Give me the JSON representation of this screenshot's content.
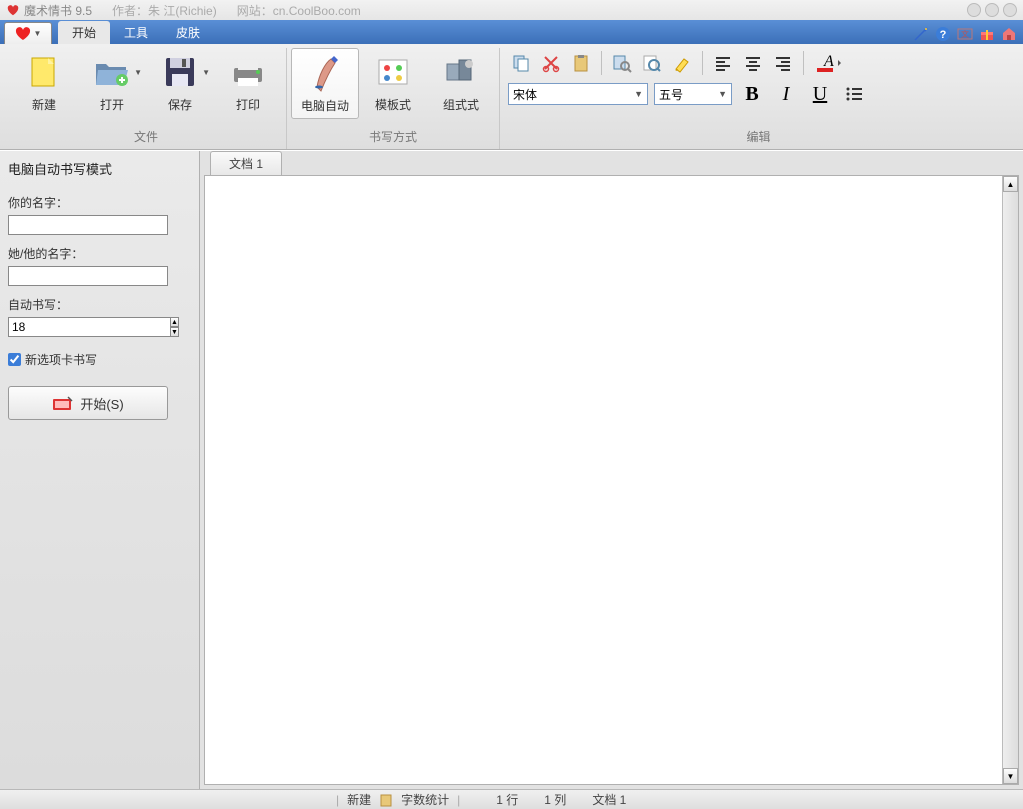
{
  "title": {
    "app": "魔术情书 9.5",
    "author": "作者：朱 江(Richie)",
    "url": "网站：cn.CoolBoo.com"
  },
  "menu": {
    "tabs": [
      "开始",
      "工具",
      "皮肤"
    ],
    "active": 0
  },
  "ribbon": {
    "file": {
      "label": "文件",
      "new": "新建",
      "open": "打开",
      "save": "保存",
      "print": "打印"
    },
    "write_mode": {
      "label": "书写方式",
      "auto": "电脑自动",
      "template": "模板式",
      "group": "组式式"
    },
    "edit": {
      "label": "编辑",
      "font": "宋体",
      "size": "五号"
    }
  },
  "sidebar": {
    "title": "电脑自动书写模式",
    "your_name_label": "你的名字：",
    "her_name_label": "她/他的名字：",
    "auto_write_label": "自动书写：",
    "auto_value": "18",
    "checkbox_label": "新选项卡书写",
    "checkbox_checked": true,
    "start_label": "开始(S)"
  },
  "doc": {
    "tab": "文档 1"
  },
  "status": {
    "new": "新建",
    "wordcount": "字数统计",
    "row": "1 行",
    "col": "1 列",
    "doc": "文档 1"
  }
}
